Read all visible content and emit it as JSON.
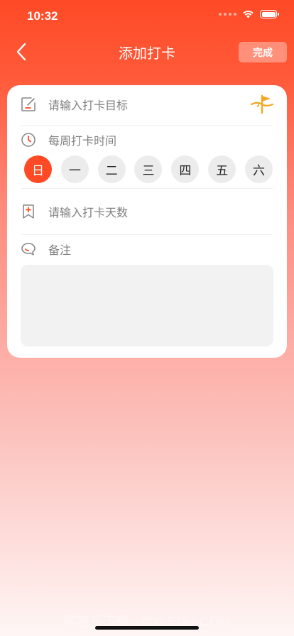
{
  "status_bar": {
    "time": "10:32"
  },
  "nav": {
    "title": "添加打卡",
    "done_label": "完成"
  },
  "form": {
    "goal_placeholder": "请输入打卡目标",
    "weekly_label": "每周打卡时间",
    "days": [
      "日",
      "一",
      "二",
      "三",
      "四",
      "五",
      "六"
    ],
    "selected_days": [
      "日"
    ],
    "days_placeholder": "请输入打卡天数",
    "remark_label": "备注",
    "remark_value": ""
  },
  "watermark": "藏嘻乐下载 · CXLEDU.COM",
  "colors": {
    "accent": "#ff4a26",
    "flag": "#f5a623",
    "icon_gray": "#8a8a8a",
    "icon_red": "#ff4a26"
  },
  "icons": {
    "back": "chevron-left-icon",
    "goal": "edit-note-icon",
    "weekly": "clock-icon",
    "days": "bookmark-plus-icon",
    "remark": "chat-bubble-icon",
    "target": "flag-icon"
  }
}
